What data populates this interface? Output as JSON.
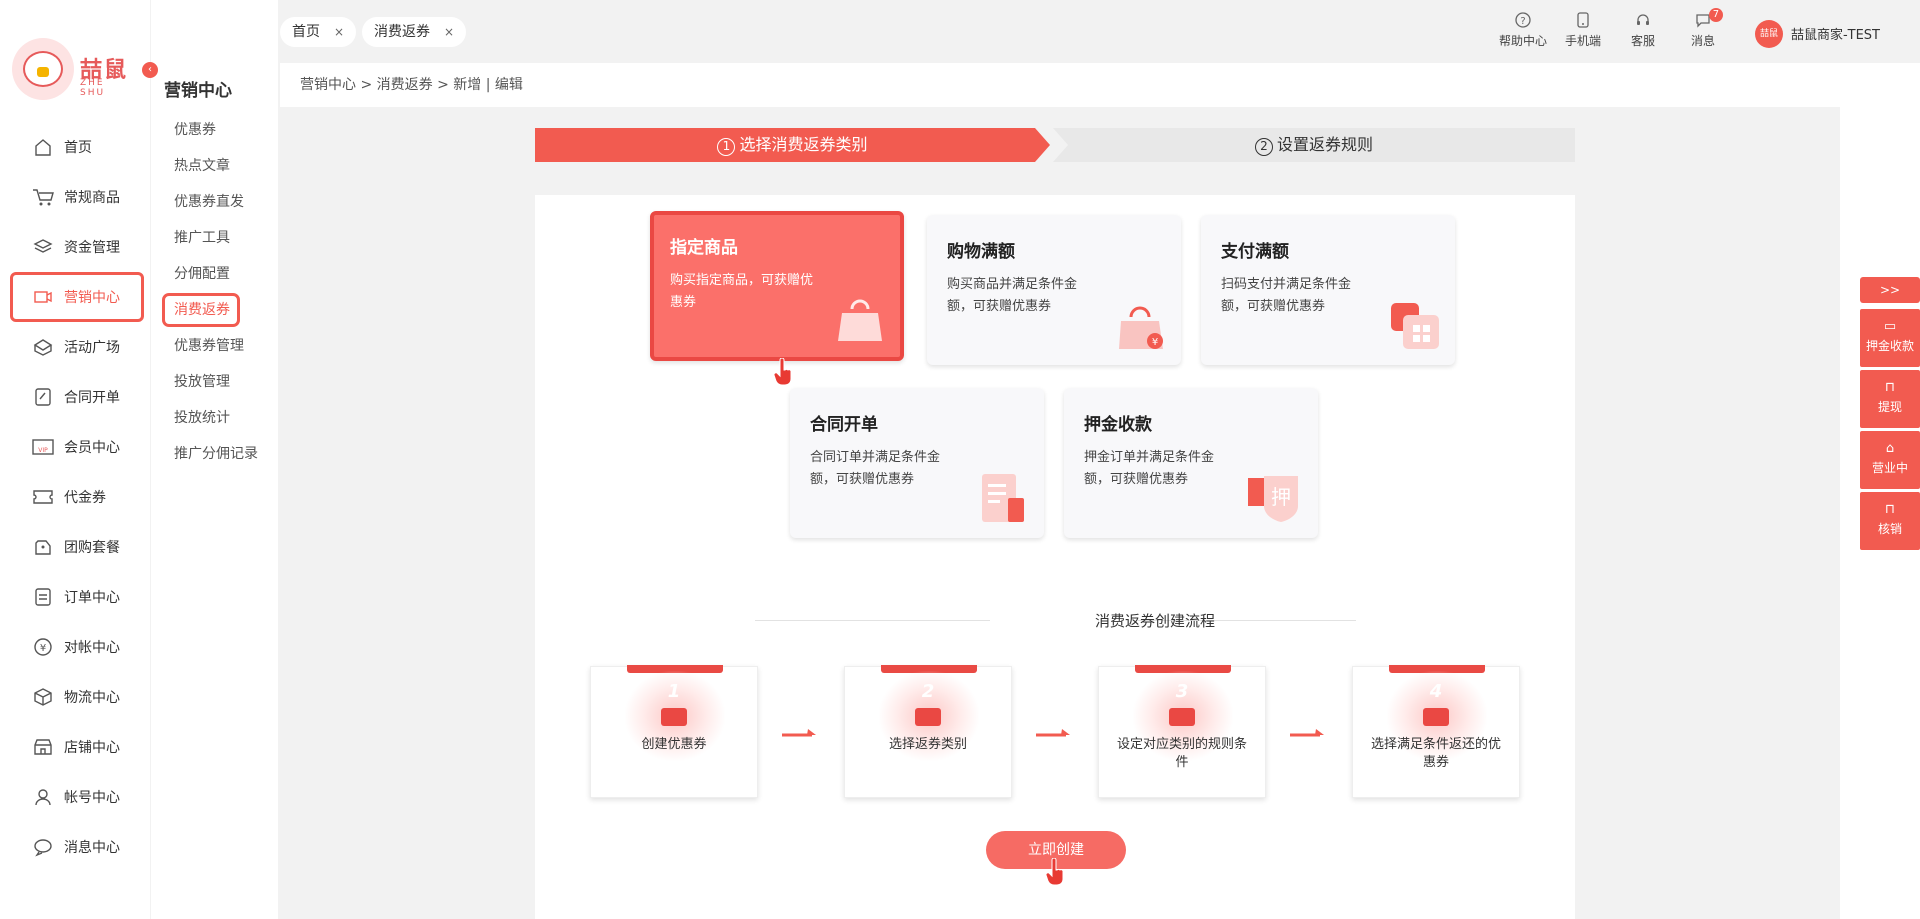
{
  "brand": {
    "name": "喆鼠",
    "sub": "ZHE SHU"
  },
  "nav": [
    {
      "label": "首页",
      "icon": "home-icon"
    },
    {
      "label": "常规商品",
      "icon": "cart-icon"
    },
    {
      "label": "资金管理",
      "icon": "layers-icon"
    },
    {
      "label": "营销中心",
      "icon": "marketing-icon",
      "active": true
    },
    {
      "label": "活动广场",
      "icon": "activity-icon"
    },
    {
      "label": "合同开单",
      "icon": "contract-icon"
    },
    {
      "label": "会员中心",
      "icon": "vip-icon"
    },
    {
      "label": "代金券",
      "icon": "coupon-icon"
    },
    {
      "label": "团购套餐",
      "icon": "group-buy-icon"
    },
    {
      "label": "订单中心",
      "icon": "order-icon"
    },
    {
      "label": "对帐中心",
      "icon": "yen-icon"
    },
    {
      "label": "物流中心",
      "icon": "box-icon"
    },
    {
      "label": "店铺中心",
      "icon": "store-icon"
    },
    {
      "label": "帐号中心",
      "icon": "user-icon"
    },
    {
      "label": "消息中心",
      "icon": "message-icon"
    }
  ],
  "subnav": {
    "title": "营销中心",
    "items": [
      "优惠券",
      "热点文章",
      "优惠券直发",
      "推广工具",
      "分佣配置",
      "消费返券",
      "优惠券管理",
      "投放管理",
      "投放统计",
      "推广分佣记录"
    ],
    "active_index": 5
  },
  "tabs": [
    {
      "label": "首页"
    },
    {
      "label": "消费返券"
    }
  ],
  "topbar": {
    "help": "帮助中心",
    "mobile": "手机端",
    "service": "客服",
    "message": "消息",
    "message_count": "7",
    "avatar_text": "喆鼠",
    "user": "喆鼠商家-TEST"
  },
  "breadcrumb": "营销中心  > 消费返券  > 新增 | 编辑",
  "steps": [
    {
      "num": "1",
      "label": "选择消费返券类别",
      "active": true
    },
    {
      "num": "2",
      "label": "设置返券规则",
      "active": false
    }
  ],
  "cards": [
    {
      "title": "指定商品",
      "desc": "购买指定商品，可获赠优惠券",
      "icon": "shopping-bag-icon",
      "active": true
    },
    {
      "title": "购物满额",
      "desc": "购买商品并满足条件金额，可获赠优惠券",
      "icon": "money-bag-icon"
    },
    {
      "title": "支付满额",
      "desc": "扫码支付并满足条件金额，可获赠优惠券",
      "icon": "qr-pay-icon"
    },
    {
      "title": "合同开单",
      "desc": "合同订单并满足条件金额，可获赠优惠券",
      "icon": "document-icon"
    },
    {
      "title": "押金收款",
      "desc": "押金订单并满足条件金额，可获赠优惠券",
      "icon": "deposit-shield-icon",
      "badge": "押"
    }
  ],
  "flow": {
    "title": "消费返券创建流程",
    "steps": [
      {
        "num": "1",
        "label": "创建优惠券"
      },
      {
        "num": "2",
        "label": "选择返券类别"
      },
      {
        "num": "3",
        "label": "设定对应类别的规则条件"
      },
      {
        "num": "4",
        "label": "选择满足条件返还的优惠券"
      }
    ]
  },
  "create_button": "立即创建",
  "side_tools": {
    "toggle": ">>",
    "items": [
      {
        "label": "押金收款",
        "icon": "card-icon"
      },
      {
        "label": "提现",
        "icon": "bookmark-icon"
      },
      {
        "label": "营业中",
        "icon": "shop-icon"
      },
      {
        "label": "核销",
        "icon": "bookmark-icon"
      }
    ]
  },
  "colors": {
    "accent": "#f25b50",
    "card_active": "#fb706a",
    "background": "#f2f2f2"
  }
}
